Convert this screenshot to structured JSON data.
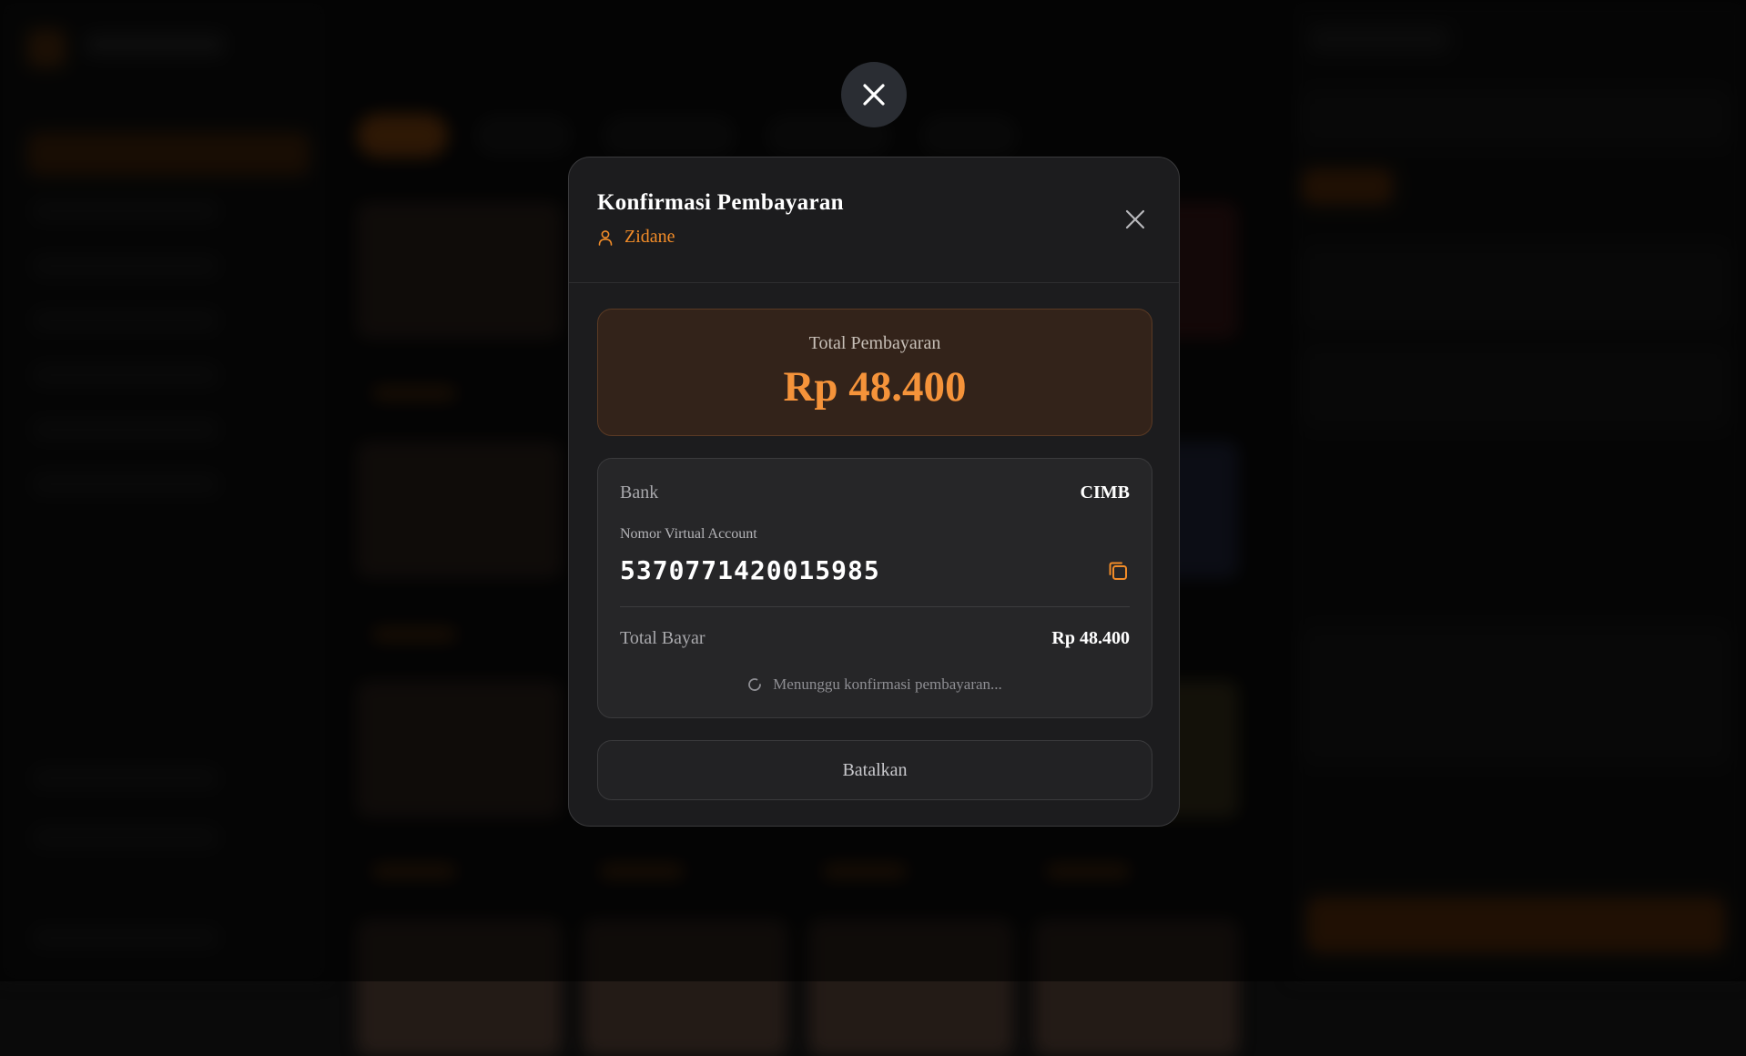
{
  "modal": {
    "title": "Konfirmasi Pembayaran",
    "customer_name": "Zidane",
    "total_label": "Total Pembayaran",
    "total_amount": "Rp 48.400",
    "bank_label": "Bank",
    "bank_value": "CIMB",
    "va_label": "Nomor Virtual Account",
    "va_number": "5370771420015985",
    "total_bayar_label": "Total Bayar",
    "total_bayar_value": "Rp 48.400",
    "waiting_text": "Menunggu konfirmasi pembayaran...",
    "cancel_label": "Batalkan"
  },
  "icons": {
    "outer_close": "close-icon",
    "modal_close": "close-icon",
    "user": "user-icon",
    "copy": "copy-icon",
    "spinner": "loading-spinner-icon"
  },
  "colors": {
    "accent": "#f28c28",
    "amount": "#f5933a",
    "modal_bg": "#1c1c1e",
    "total_box_bg": "#33231a"
  }
}
